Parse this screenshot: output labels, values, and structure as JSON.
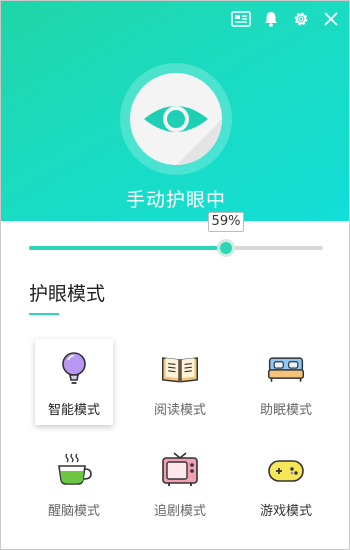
{
  "header": {
    "status_title": "手动护眼中",
    "actions": [
      {
        "name": "news-icon"
      },
      {
        "name": "bell-icon"
      },
      {
        "name": "gear-icon"
      },
      {
        "name": "close-icon"
      }
    ],
    "colors": {
      "gradient_start": "#1fd6a8",
      "gradient_end": "#12dfd8",
      "accent": "#2bd6b6"
    }
  },
  "brightness": {
    "value_label": "59%",
    "level": 0.59
  },
  "modes_section": {
    "title": "护眼模式",
    "items": [
      {
        "label": "智能模式",
        "icon": "bulb-icon",
        "selected": true
      },
      {
        "label": "阅读模式",
        "icon": "book-icon",
        "selected": false
      },
      {
        "label": "助眠模式",
        "icon": "bed-icon",
        "selected": false
      },
      {
        "label": "醒脑模式",
        "icon": "tea-cup-icon",
        "selected": false
      },
      {
        "label": "追剧模式",
        "icon": "tv-icon",
        "selected": false
      },
      {
        "label": "游戏模式",
        "icon": "gamepad-icon",
        "selected": false
      }
    ]
  }
}
